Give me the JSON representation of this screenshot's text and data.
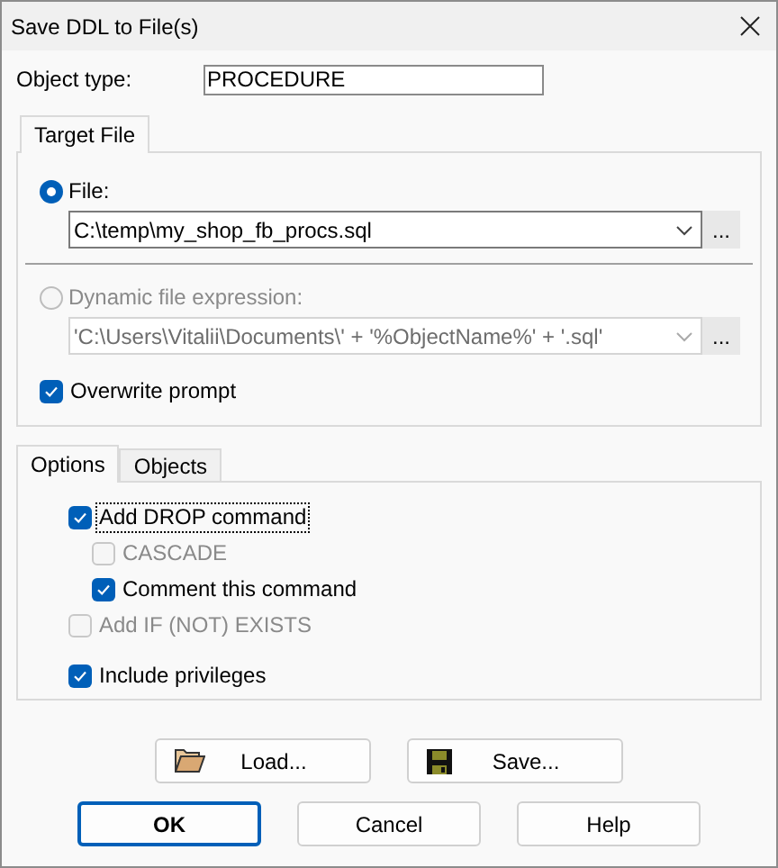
{
  "window": {
    "title": "Save DDL to File(s)"
  },
  "object_type": {
    "label": "Object type:",
    "value": "PROCEDURE"
  },
  "target_tabs": [
    {
      "label": "Target File",
      "selected": true
    }
  ],
  "target_options": [
    {
      "label": "File:",
      "selected": true,
      "disabled": false,
      "value": "C:\\temp\\my_shop_fb_procs.sql",
      "browse": "..."
    },
    {
      "label": "Dynamic file expression:",
      "selected": false,
      "disabled": true,
      "value": "'C:\\Users\\Vitalii\\Documents\\' + '%ObjectName%' + '.sql'",
      "browse": "..."
    }
  ],
  "overwrite": {
    "label": "Overwrite prompt",
    "checked": true,
    "disabled": false,
    "focused": false
  },
  "option_tabs": [
    {
      "label": "Options",
      "selected": true
    },
    {
      "label": "Objects",
      "selected": false
    }
  ],
  "option_groups": [
    [
      {
        "label": "Add DROP command",
        "checked": true,
        "disabled": false,
        "focused": true,
        "children": [
          {
            "label": "CASCADE",
            "checked": false,
            "disabled": true,
            "focused": false
          },
          {
            "label": "Comment this command",
            "checked": true,
            "disabled": false,
            "focused": false
          }
        ]
      },
      {
        "label": "Add IF (NOT) EXISTS",
        "checked": false,
        "disabled": true,
        "focused": false
      }
    ],
    [
      {
        "label": "Include privileges",
        "checked": true,
        "disabled": false,
        "focused": false
      }
    ]
  ],
  "file_buttons": [
    {
      "label": "Load...",
      "kind": "load"
    },
    {
      "label": "Save...",
      "kind": "save"
    }
  ],
  "dialog_buttons": [
    {
      "label": "OK",
      "default": true
    },
    {
      "label": "Cancel",
      "default": false
    },
    {
      "label": "Help",
      "default": false
    }
  ]
}
